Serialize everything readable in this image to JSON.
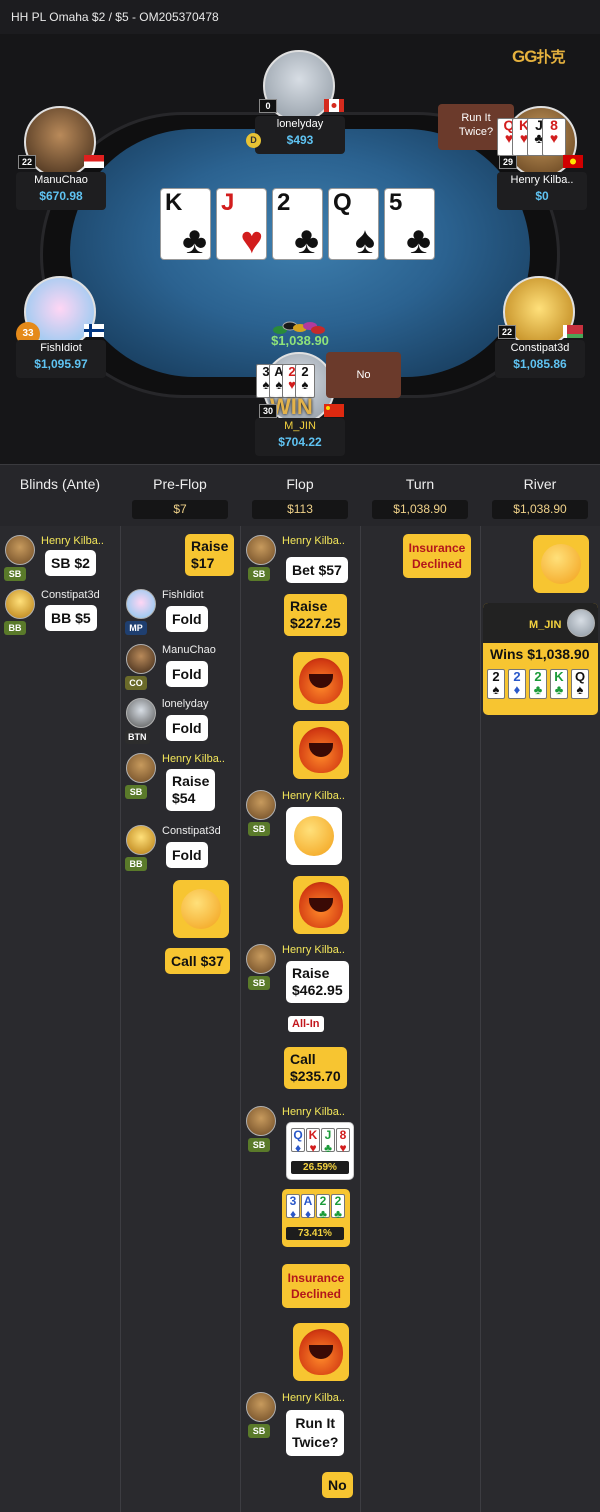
{
  "title": "HH PL Omaha $2 / $5   - OM205370478",
  "logo": {
    "text": "GG",
    "suffix": "扑克"
  },
  "table": {
    "board": [
      {
        "rank": "K",
        "suit": "♣",
        "color": "black"
      },
      {
        "rank": "J",
        "suit": "♥",
        "color": "red"
      },
      {
        "rank": "2",
        "suit": "♣",
        "color": "black"
      },
      {
        "rank": "Q",
        "suit": "♠",
        "color": "black"
      },
      {
        "rank": "5",
        "suit": "♣",
        "color": "black"
      }
    ],
    "pot": "$1,038.90",
    "dealer": "D",
    "run_it_twice": "Run It Twice?",
    "no_label": "No",
    "seats": {
      "top": {
        "name": "lonelyday",
        "stack": "$493",
        "level": "0"
      },
      "top_left": {
        "name": "ManuChao",
        "stack": "$670.98",
        "level": "22"
      },
      "top_right": {
        "name": "Henry Kilba..",
        "stack": "$0",
        "level": "29"
      },
      "left": {
        "name": "FishIdiot",
        "stack": "$1,095.97",
        "level": "33"
      },
      "right": {
        "name": "Constipat3d",
        "stack": "$1,085.86",
        "level": "22"
      },
      "bottom": {
        "name": "M_JIN",
        "stack": "$704.22",
        "level": "30",
        "overlay": "WIN"
      }
    },
    "henry_cards": [
      {
        "rank": "Q",
        "suit": "♥",
        "color": "red"
      },
      {
        "rank": "K",
        "suit": "♥",
        "color": "red"
      },
      {
        "rank": "J",
        "suit": "♣",
        "color": "black"
      },
      {
        "rank": "8",
        "suit": "♥",
        "color": "red"
      }
    ],
    "jin_cards": [
      {
        "rank": "3",
        "suit": "♠",
        "color": "black"
      },
      {
        "rank": "A",
        "suit": "♠",
        "color": "black"
      },
      {
        "rank": "2",
        "suit": "♥",
        "color": "red"
      },
      {
        "rank": "2",
        "suit": "♠",
        "color": "black"
      }
    ]
  },
  "streets": [
    {
      "name": "Blinds (Ante)",
      "pot": ""
    },
    {
      "name": "Pre-Flop",
      "pot": "$7"
    },
    {
      "name": "Flop",
      "pot": "$113"
    },
    {
      "name": "Turn",
      "pot": "$1,038.90"
    },
    {
      "name": "River",
      "pot": "$1,038.90"
    }
  ],
  "blinds": {
    "p1": {
      "name": "Henry Kilba..",
      "pos": "SB",
      "action": "SB $2"
    },
    "p2": {
      "name": "Constipat3d",
      "pos": "BB",
      "action": "BB $5"
    }
  },
  "preflop": {
    "raise1": "Raise\n$17",
    "fishidiot": {
      "name": "FishIdiot",
      "pos": "MP",
      "action": "Fold"
    },
    "manuchao": {
      "name": "ManuChao",
      "pos": "CO",
      "action": "Fold"
    },
    "lonelyday": {
      "name": "lonelyday",
      "pos": "BTN",
      "action": "Fold"
    },
    "henry": {
      "name": "Henry Kilba..",
      "pos": "SB",
      "action": "Raise\n$54"
    },
    "constipat": {
      "name": "Constipat3d",
      "pos": "BB",
      "action": "Fold"
    },
    "call": "Call  $37"
  },
  "flop": {
    "h1": {
      "name": "Henry Kilba..",
      "pos": "SB",
      "action": "Bet  $57"
    },
    "raise_jin": "Raise\n$227.25",
    "h2": {
      "name": "Henry Kilba..",
      "pos": "SB"
    },
    "h3": {
      "name": "Henry Kilba..",
      "pos": "SB",
      "action": "Raise\n$462.95",
      "tag": "All-In"
    },
    "call_jin": "Call\n$235.70",
    "h4": {
      "name": "Henry Kilba..",
      "pos": "SB",
      "pct": "26.59%"
    },
    "henry_show": [
      {
        "rank": "Q",
        "color": "blue",
        "suit": "♦"
      },
      {
        "rank": "K",
        "color": "red",
        "suit": "♥"
      },
      {
        "rank": "J",
        "color": "green",
        "suit": "♣"
      },
      {
        "rank": "8",
        "color": "red",
        "suit": "♥"
      }
    ],
    "jin_show": [
      {
        "rank": "3",
        "color": "blue",
        "suit": "♦"
      },
      {
        "rank": "A",
        "color": "blue",
        "suit": "♦"
      },
      {
        "rank": "2",
        "color": "green",
        "suit": "♣"
      },
      {
        "rank": "2",
        "color": "green",
        "suit": "♣"
      }
    ],
    "jin_pct": "73.41%",
    "insurance": "Insurance\nDeclined",
    "h5": {
      "name": "Henry Kilba..",
      "pos": "SB",
      "action": "Run It\nTwice?"
    },
    "no": "No"
  },
  "turn": {
    "insurance": "Insurance\nDeclined"
  },
  "river": {
    "winner": "M_JIN",
    "wins": "Wins $1,038.90",
    "hand": [
      {
        "rank": "2",
        "color": "black",
        "suit": "♠"
      },
      {
        "rank": "2",
        "color": "blue",
        "suit": "♦"
      },
      {
        "rank": "2",
        "color": "green",
        "suit": "♣"
      },
      {
        "rank": "K",
        "color": "green",
        "suit": "♣"
      },
      {
        "rank": "Q",
        "color": "black",
        "suit": "♠"
      }
    ]
  },
  "colors": {
    "accent": "#f7c531",
    "stack": "#5fc3f2",
    "pot": "#8fe37a",
    "name_highlight": "#f3e65a"
  }
}
